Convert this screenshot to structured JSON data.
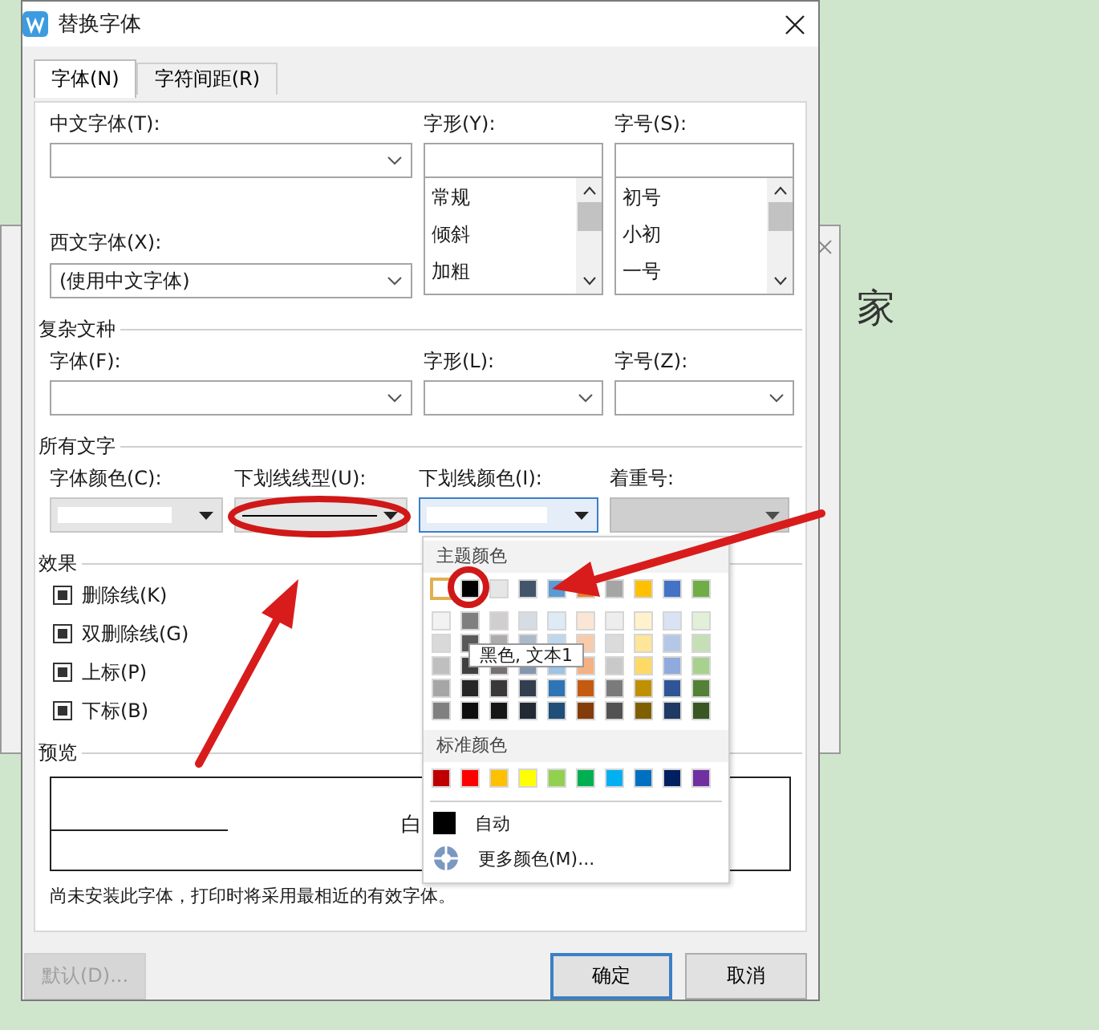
{
  "background": {
    "document_text": "家"
  },
  "window": {
    "title": "替换字体"
  },
  "tabs": [
    {
      "label": "字体(N)",
      "selected": true
    },
    {
      "label": "字符间距(R)",
      "selected": false
    }
  ],
  "chinese_font": {
    "label": "中文字体(T):"
  },
  "font_style": {
    "label": "字形(Y):",
    "options": [
      "常规",
      "倾斜",
      "加粗"
    ]
  },
  "font_size": {
    "label": "字号(S):",
    "options": [
      "初号",
      "小初",
      "一号"
    ]
  },
  "western_font": {
    "label": "西文字体(X):",
    "value": "(使用中文字体)"
  },
  "complex_script": {
    "title": "复杂文种",
    "fields": [
      {
        "label": "字体(F):"
      },
      {
        "label": "字形(L):"
      },
      {
        "label": "字号(Z):"
      }
    ]
  },
  "all_text": {
    "title": "所有文字",
    "fields": [
      {
        "label": "字体颜色(C):",
        "kind": "swatch",
        "open": false,
        "disabled": false
      },
      {
        "label": "下划线线型(U):",
        "kind": "line",
        "open": false,
        "disabled": false
      },
      {
        "label": "下划线颜色(I):",
        "kind": "swatch",
        "open": true,
        "disabled": false
      },
      {
        "label": "着重号:",
        "kind": "blank",
        "open": false,
        "disabled": true
      }
    ]
  },
  "effects": {
    "title": "效果",
    "items": [
      {
        "label": "删除线(K)",
        "mixed": true
      },
      {
        "label": "双删除线(G)",
        "mixed": true
      },
      {
        "label": "上标(P)",
        "mixed": true
      },
      {
        "label": "下标(B)",
        "mixed": true
      }
    ]
  },
  "preview": {
    "title": "预览",
    "sample": "白",
    "note": "尚未安装此字体，打印时将采用最相近的有效字体。"
  },
  "buttons": [
    {
      "label": "默认(D)...",
      "disabled": true,
      "default": false
    },
    {
      "label": "确定",
      "disabled": false,
      "default": true
    },
    {
      "label": "取消",
      "disabled": false,
      "default": false
    }
  ],
  "color_menu": {
    "theme_title": "主题颜色",
    "theme_colors": [
      {
        "color": "#ffffff",
        "selected": true
      },
      {
        "color": "#000000",
        "selected": false
      },
      {
        "color": "#e7e6e6",
        "selected": false
      },
      {
        "color": "#44546a",
        "selected": false
      },
      {
        "color": "#5b9bd5",
        "selected": false
      },
      {
        "color": "#ed7d31",
        "selected": false
      },
      {
        "color": "#a5a5a5",
        "selected": false
      },
      {
        "color": "#ffc000",
        "selected": false
      },
      {
        "color": "#4472c4",
        "selected": false
      },
      {
        "color": "#70ad47",
        "selected": false
      }
    ],
    "tint_rows": [
      {
        "swatches": [
          {
            "color": "#f2f2f2"
          },
          {
            "color": "#7f7f7f"
          },
          {
            "color": "#d0cece"
          },
          {
            "color": "#d6dce4"
          },
          {
            "color": "#deebf6"
          },
          {
            "color": "#fbe5d5"
          },
          {
            "color": "#ededed"
          },
          {
            "color": "#fff2cc"
          },
          {
            "color": "#dae3f3"
          },
          {
            "color": "#e2f0d9"
          }
        ]
      },
      {
        "swatches": [
          {
            "color": "#d9d9d9"
          },
          {
            "color": "#595959"
          },
          {
            "color": "#aeabab"
          },
          {
            "color": "#adb9ca"
          },
          {
            "color": "#bdd7ee"
          },
          {
            "color": "#f7cbac"
          },
          {
            "color": "#dbdbdb"
          },
          {
            "color": "#fee599"
          },
          {
            "color": "#b4c7e7"
          },
          {
            "color": "#c5e0b4"
          }
        ]
      },
      {
        "swatches": [
          {
            "color": "#bfbfbf"
          },
          {
            "color": "#404040"
          },
          {
            "color": "#757171"
          },
          {
            "color": "#8497b0"
          },
          {
            "color": "#9dc3e6"
          },
          {
            "color": "#f4b183"
          },
          {
            "color": "#c9c9c9"
          },
          {
            "color": "#ffd966"
          },
          {
            "color": "#8faadc"
          },
          {
            "color": "#a9d18e"
          }
        ]
      },
      {
        "swatches": [
          {
            "color": "#a6a6a6"
          },
          {
            "color": "#262626"
          },
          {
            "color": "#3a3838"
          },
          {
            "color": "#333f4f"
          },
          {
            "color": "#2e75b5"
          },
          {
            "color": "#c55a11"
          },
          {
            "color": "#7b7b7b"
          },
          {
            "color": "#bf9000"
          },
          {
            "color": "#2f5597"
          },
          {
            "color": "#538135"
          }
        ]
      },
      {
        "swatches": [
          {
            "color": "#808080"
          },
          {
            "color": "#0d0d0d"
          },
          {
            "color": "#171616"
          },
          {
            "color": "#222a35"
          },
          {
            "color": "#1f4e79"
          },
          {
            "color": "#843c0b"
          },
          {
            "color": "#525252"
          },
          {
            "color": "#7f6000"
          },
          {
            "color": "#1f3864"
          },
          {
            "color": "#385723"
          }
        ]
      }
    ],
    "tooltip": "黑色, 文本1",
    "standard_title": "标准颜色",
    "standard_colors": [
      {
        "color": "#c00000"
      },
      {
        "color": "#ff0000"
      },
      {
        "color": "#ffc000"
      },
      {
        "color": "#ffff00"
      },
      {
        "color": "#92d050"
      },
      {
        "color": "#00b050"
      },
      {
        "color": "#00b0f0"
      },
      {
        "color": "#0070c0"
      },
      {
        "color": "#002060"
      },
      {
        "color": "#7030a0"
      }
    ],
    "auto": {
      "label": "自动",
      "color": "#000000"
    },
    "more": "更多颜色(M)..."
  }
}
